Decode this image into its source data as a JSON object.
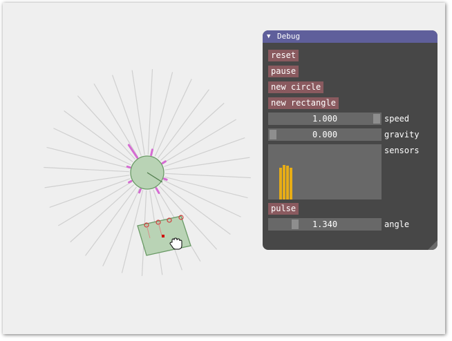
{
  "debug": {
    "title": "Debug",
    "collapse_glyph": "▼",
    "buttons": {
      "reset": "reset",
      "pause": "pause",
      "new_circle": "new circle",
      "new_rectangle": "new rectangle",
      "pulse": "pulse"
    },
    "speed": {
      "value": "1.000",
      "label": "speed",
      "level": 1.0
    },
    "gravity": {
      "value": "0.000",
      "label": "gravity",
      "level": 0.0
    },
    "sensors": {
      "label": "sensors",
      "values": [
        0.58,
        0.62,
        0.61,
        0.57
      ]
    },
    "angle": {
      "value": "1.340",
      "label": "angle",
      "level": 0.21
    }
  },
  "colors": {
    "window_bg": "#efefef",
    "panel_bg": "#474747",
    "title_bg": "#5f5f9b",
    "button": "#8a5a5f",
    "slider_bg": "#686868",
    "sensor_bar": "#e7ad16",
    "body_fill": "#b9d3b5",
    "body_stroke": "#6a9a66",
    "ray": "#cfcfcf",
    "hit": "#d56bd2",
    "contact": "#d23c3c"
  },
  "scene": {
    "ray_count": 32,
    "cursor_icon": "hand-cursor-icon",
    "body_icons": [
      "circle-body",
      "rectangle-body"
    ]
  }
}
